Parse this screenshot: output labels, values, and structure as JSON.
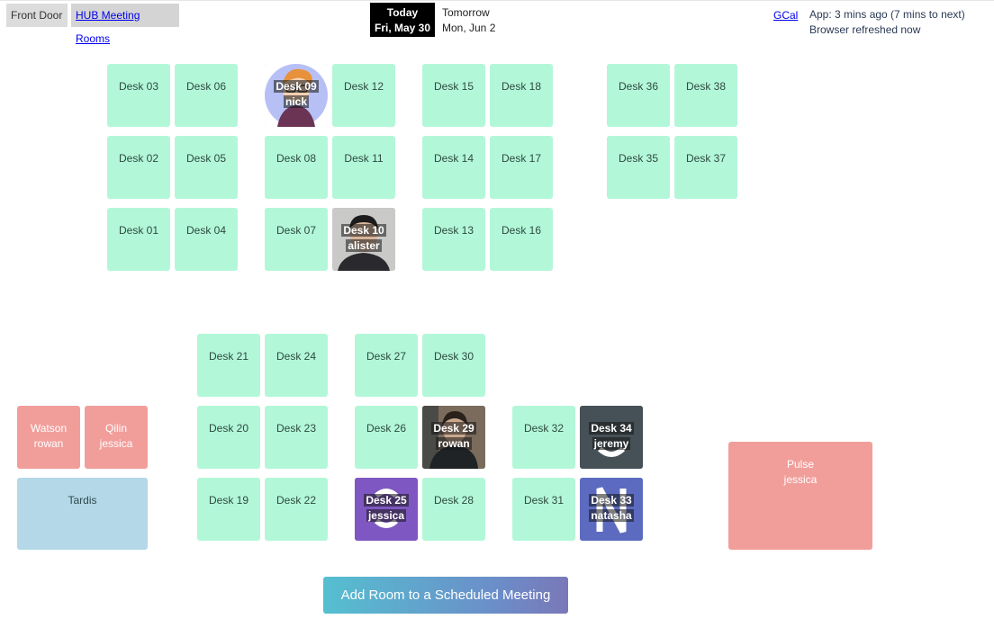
{
  "nav": {
    "front_door": "Front Door",
    "hub_rooms": "HUB Meeting Rooms"
  },
  "days": {
    "today_label": "Today",
    "today_date": "Fri, May 30",
    "tomorrow_label": "Tomorrow",
    "tomorrow_date": "Mon, Jun 2"
  },
  "header": {
    "gcal": "GCal",
    "app_status": "App: 3 mins ago (7 mins to next)",
    "browser_status": "Browser refreshed now"
  },
  "desks": {
    "d01": {
      "label": "Desk 01"
    },
    "d02": {
      "label": "Desk 02"
    },
    "d03": {
      "label": "Desk 03"
    },
    "d04": {
      "label": "Desk 04"
    },
    "d05": {
      "label": "Desk 05"
    },
    "d06": {
      "label": "Desk 06"
    },
    "d07": {
      "label": "Desk 07"
    },
    "d08": {
      "label": "Desk 08"
    },
    "d09": {
      "label": "Desk 09",
      "occupant": "nick"
    },
    "d10": {
      "label": "Desk 10",
      "occupant": "alister"
    },
    "d11": {
      "label": "Desk 11"
    },
    "d12": {
      "label": "Desk 12"
    },
    "d13": {
      "label": "Desk 13"
    },
    "d14": {
      "label": "Desk 14"
    },
    "d15": {
      "label": "Desk 15"
    },
    "d16": {
      "label": "Desk 16"
    },
    "d17": {
      "label": "Desk 17"
    },
    "d18": {
      "label": "Desk 18"
    },
    "d19": {
      "label": "Desk 19"
    },
    "d20": {
      "label": "Desk 20"
    },
    "d21": {
      "label": "Desk 21"
    },
    "d22": {
      "label": "Desk 22"
    },
    "d23": {
      "label": "Desk 23"
    },
    "d24": {
      "label": "Desk 24"
    },
    "d25": {
      "label": "Desk 25",
      "occupant": "jessica"
    },
    "d26": {
      "label": "Desk 26"
    },
    "d27": {
      "label": "Desk 27"
    },
    "d28": {
      "label": "Desk 28"
    },
    "d29": {
      "label": "Desk 29",
      "occupant": "rowan"
    },
    "d30": {
      "label": "Desk 30"
    },
    "d31": {
      "label": "Desk 31"
    },
    "d32": {
      "label": "Desk 32"
    },
    "d33": {
      "label": "Desk 33",
      "occupant": "natasha"
    },
    "d34": {
      "label": "Desk 34",
      "occupant": "jeremy"
    },
    "d35": {
      "label": "Desk 35"
    },
    "d36": {
      "label": "Desk 36"
    },
    "d37": {
      "label": "Desk 37"
    },
    "d38": {
      "label": "Desk 38"
    }
  },
  "rooms": {
    "watson": {
      "name": "Watson",
      "occupant": "rowan"
    },
    "qilin": {
      "name": "Qilin",
      "occupant": "jessica"
    },
    "tardis": {
      "name": "Tardis"
    },
    "pulse": {
      "name": "Pulse",
      "occupant": "jessica"
    }
  },
  "colors": {
    "desk_free": "#b3f7d9",
    "room_booked": "#f19e9b",
    "room_free": "#b4d8e8",
    "today_bg": "#000000"
  },
  "add_button": "Add Room to a Scheduled Meeting"
}
